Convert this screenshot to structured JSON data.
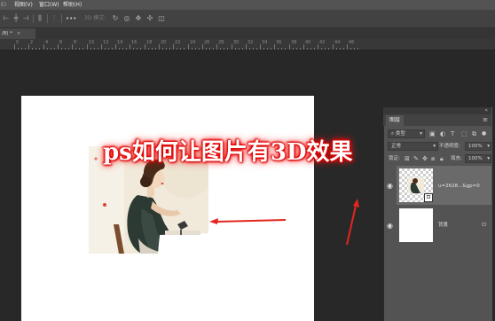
{
  "menu": {
    "items": [
      {
        "label": "E)"
      },
      {
        "label": "视图(V)"
      },
      {
        "label": "窗口(W)"
      },
      {
        "label": "帮助(H)"
      }
    ]
  },
  "options": {
    "mode_3d_label": "3D 模式：",
    "icons": [
      "align-left-icon",
      "align-center-icon",
      "align-right-icon",
      "distribute-icon",
      "more-icon",
      "rotate-3d-icon",
      "roll-3d-icon",
      "drag-3d-icon",
      "slide-3d-icon",
      "scale-3d-icon"
    ]
  },
  "document": {
    "tab_label": "/8) *",
    "tab_close": "×"
  },
  "ruler": {
    "labels": [
      "0",
      "2",
      "4",
      "6",
      "8",
      "10",
      "12",
      "14",
      "16",
      "18",
      "20",
      "22",
      "24",
      "26",
      "28",
      "30",
      "32",
      "34",
      "36",
      "38",
      "40",
      "42",
      "44",
      "46"
    ]
  },
  "overlay": {
    "title": "ps如何让图片有3D效果"
  },
  "layers_panel": {
    "tab_label": "图层",
    "filter_label": "类型",
    "blend_mode": "正常",
    "opacity_label": "不透明度:",
    "opacity_value": "100%",
    "lock_label": "锁定:",
    "fill_label": "填充:",
    "fill_value": "100%",
    "layers": [
      {
        "name": "u=2628...&gp=0",
        "visible": true,
        "selected": true
      },
      {
        "name": "背景",
        "visible": true,
        "selected": false,
        "locked": true
      }
    ]
  },
  "colors": {
    "accent_red": "#e3261f",
    "panel_bg": "#535353",
    "app_bg": "#282828"
  }
}
